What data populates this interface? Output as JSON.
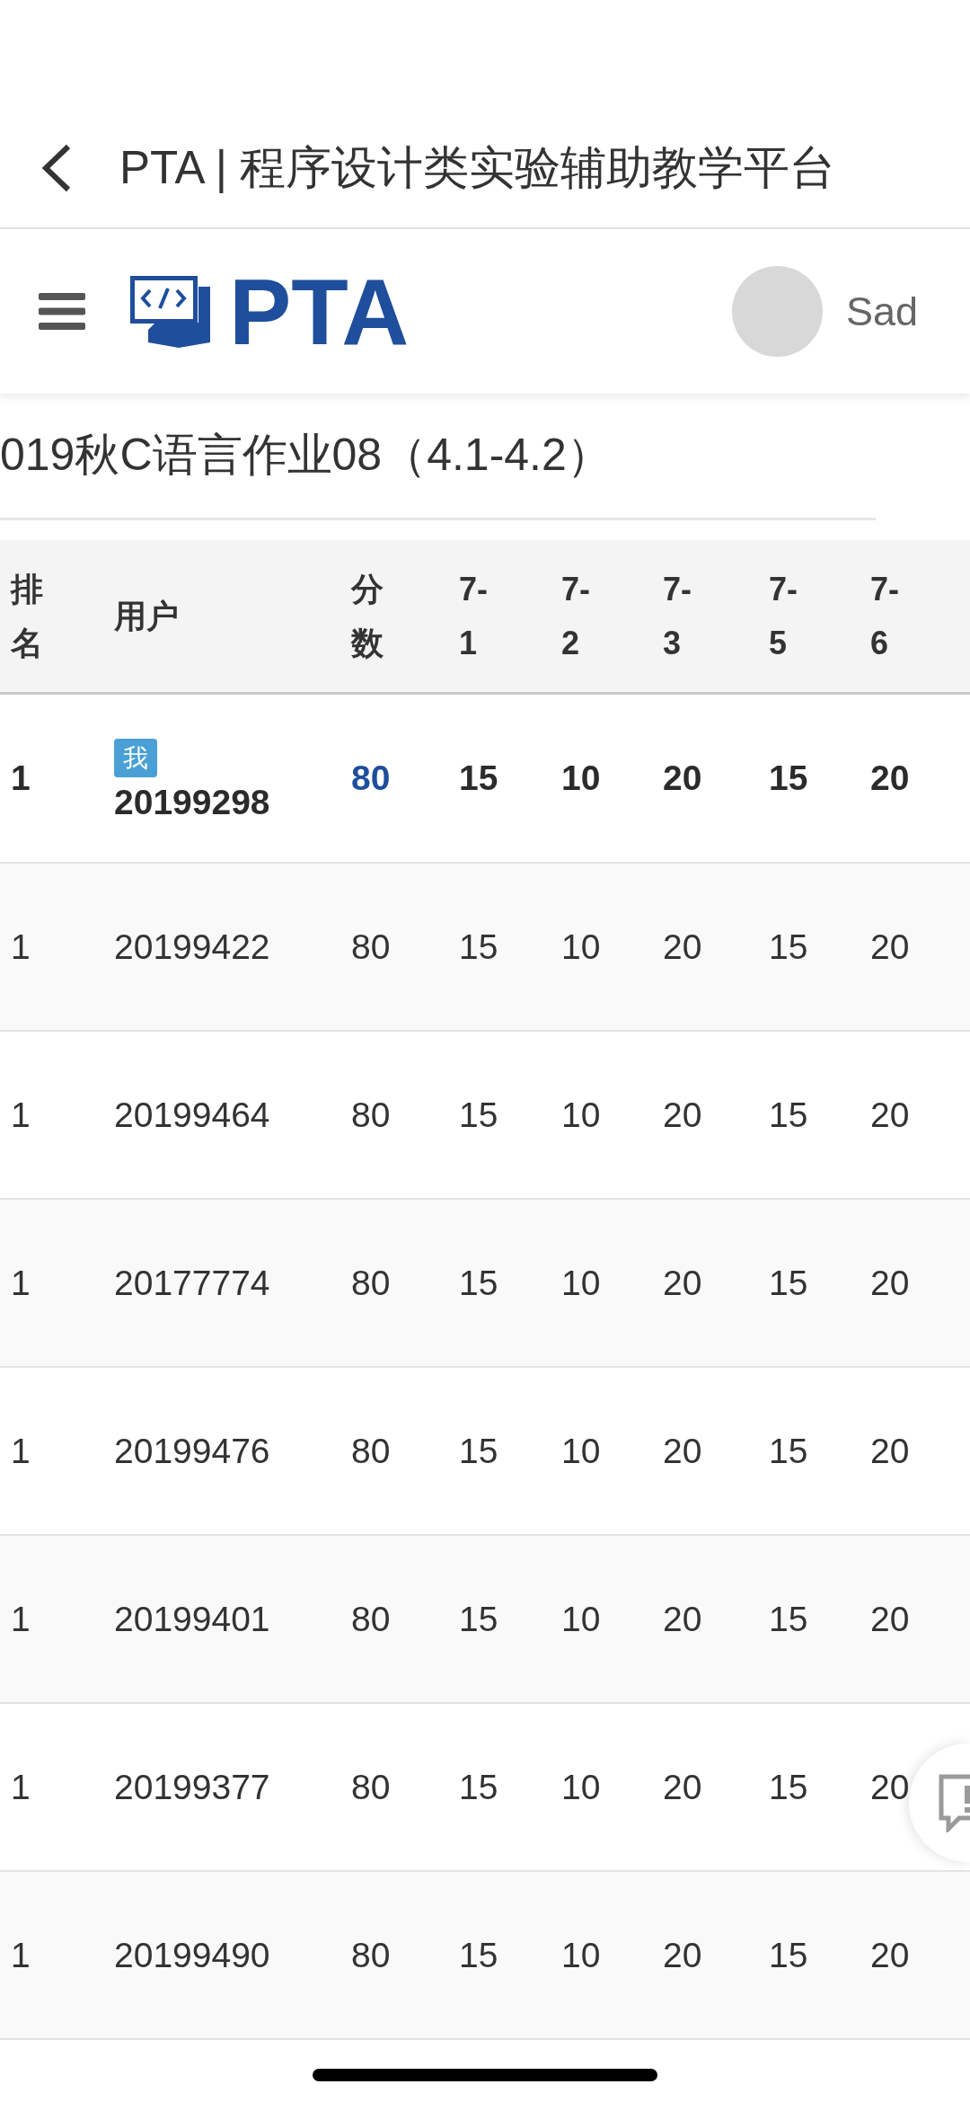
{
  "browser_bar": {
    "title": "PTA | 程序设计类实验辅助教学平台"
  },
  "header": {
    "logo_text": "PTA",
    "user_name": "Sad"
  },
  "page_title": "019秋C语言作业08（4.1-4.2）",
  "table": {
    "columns": [
      {
        "label": "排名",
        "kind": "rank"
      },
      {
        "label": "用户",
        "kind": "user"
      },
      {
        "label": "分数",
        "kind": "score"
      },
      {
        "label": "7-1",
        "kind": "problem"
      },
      {
        "label": "7-2",
        "kind": "problem"
      },
      {
        "label": "7-3",
        "kind": "problem"
      },
      {
        "label": "7-5",
        "kind": "problem"
      },
      {
        "label": "7-6",
        "kind": "problem"
      }
    ],
    "rows": [
      {
        "current_user": true,
        "badge": "我",
        "cells": [
          "1",
          "20199298",
          "80",
          "15",
          "10",
          "20",
          "15",
          "20"
        ]
      },
      {
        "current_user": false,
        "cells": [
          "1",
          "20199422",
          "80",
          "15",
          "10",
          "20",
          "15",
          "20"
        ]
      },
      {
        "current_user": false,
        "cells": [
          "1",
          "20199464",
          "80",
          "15",
          "10",
          "20",
          "15",
          "20"
        ]
      },
      {
        "current_user": false,
        "cells": [
          "1",
          "20177774",
          "80",
          "15",
          "10",
          "20",
          "15",
          "20"
        ]
      },
      {
        "current_user": false,
        "cells": [
          "1",
          "20199476",
          "80",
          "15",
          "10",
          "20",
          "15",
          "20"
        ]
      },
      {
        "current_user": false,
        "cells": [
          "1",
          "20199401",
          "80",
          "15",
          "10",
          "20",
          "15",
          "20"
        ]
      },
      {
        "current_user": false,
        "cells": [
          "1",
          "20199377",
          "80",
          "15",
          "10",
          "20",
          "15",
          "20"
        ]
      },
      {
        "current_user": false,
        "cells": [
          "1",
          "20199490",
          "80",
          "15",
          "10",
          "20",
          "15",
          "20"
        ]
      }
    ]
  }
}
